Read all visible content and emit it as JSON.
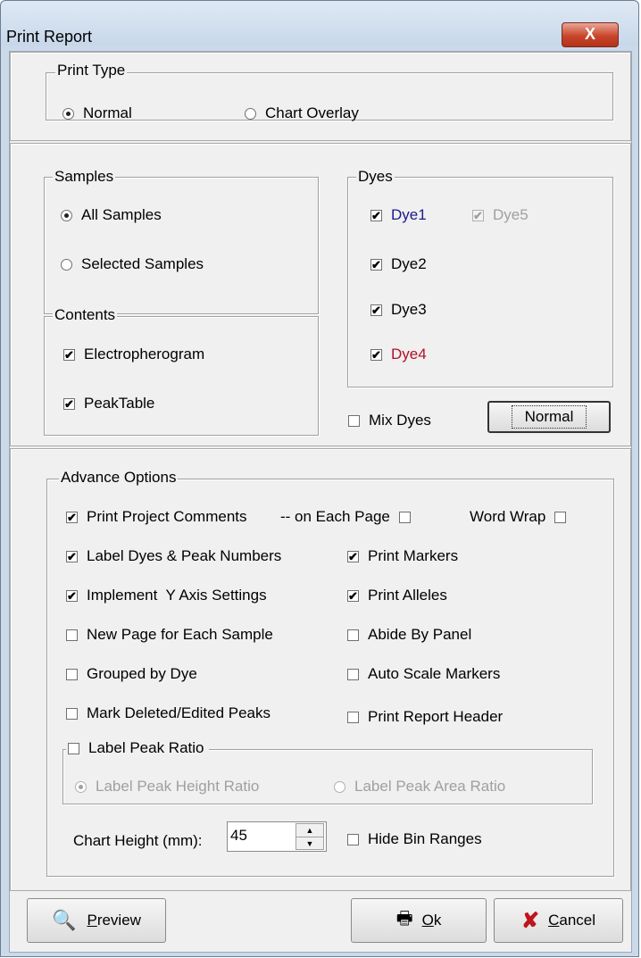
{
  "window": {
    "title": "Print Report",
    "close_label": "X"
  },
  "print_type": {
    "legend": "Print Type",
    "options": [
      {
        "label": "Normal",
        "selected": true
      },
      {
        "label": "Chart Overlay",
        "selected": false
      }
    ]
  },
  "samples": {
    "legend": "Samples",
    "options": [
      {
        "label": "All Samples",
        "selected": true
      },
      {
        "label": "Selected Samples",
        "selected": false
      }
    ]
  },
  "contents": {
    "legend": "Contents",
    "items": [
      {
        "label": "Electropherogram",
        "checked": true
      },
      {
        "label": "PeakTable",
        "checked": true
      }
    ]
  },
  "dyes": {
    "legend": "Dyes",
    "items": [
      {
        "label": "Dye1",
        "checked": true,
        "color": "#1a1a8c",
        "enabled": true
      },
      {
        "label": "Dye2",
        "checked": true,
        "color": "#000000",
        "enabled": true
      },
      {
        "label": "Dye3",
        "checked": true,
        "color": "#000000",
        "enabled": true
      },
      {
        "label": "Dye4",
        "checked": true,
        "color": "#b0102a",
        "enabled": true
      },
      {
        "label": "Dye5",
        "checked": true,
        "color": "#a0a0a0",
        "enabled": false
      }
    ],
    "mix_dyes": {
      "label": "Mix Dyes",
      "checked": false
    },
    "mode_button": "Normal"
  },
  "advance": {
    "legend": "Advance Options",
    "print_comments": {
      "label": "Print Project Comments",
      "checked": true
    },
    "on_each_page": {
      "label": "-- on Each Page",
      "checked": false
    },
    "word_wrap": {
      "label": "Word Wrap",
      "checked": false
    },
    "left_options": [
      {
        "label": "Label Dyes & Peak Numbers",
        "checked": true
      },
      {
        "label": "Implement  Y Axis Settings",
        "checked": true
      },
      {
        "label": "New Page for Each Sample",
        "checked": false
      },
      {
        "label": "Grouped by Dye",
        "checked": false
      },
      {
        "label": "Mark Deleted/Edited Peaks",
        "checked": false
      }
    ],
    "right_options": [
      {
        "label": "Print Markers",
        "checked": true
      },
      {
        "label": "Print Alleles",
        "checked": true
      },
      {
        "label": "Abide By Panel",
        "checked": false
      },
      {
        "label": "Auto Scale Markers",
        "checked": false
      },
      {
        "label": "Print Report Header",
        "checked": false
      }
    ],
    "label_peak_ratio": {
      "label": "Label Peak Ratio",
      "checked": false,
      "options": [
        {
          "label": "Label Peak Height Ratio",
          "selected": true
        },
        {
          "label": "Label Peak Area Ratio",
          "selected": false
        }
      ]
    },
    "chart_height": {
      "label": "Chart Height (mm):",
      "value": "45"
    },
    "hide_bin_ranges": {
      "label": "Hide Bin Ranges",
      "checked": false
    }
  },
  "footer": {
    "preview": {
      "prefix": "",
      "underline": "P",
      "rest": "review"
    },
    "ok": {
      "underline": "O",
      "rest": "k"
    },
    "cancel": {
      "underline": "C",
      "rest": "ancel"
    }
  }
}
